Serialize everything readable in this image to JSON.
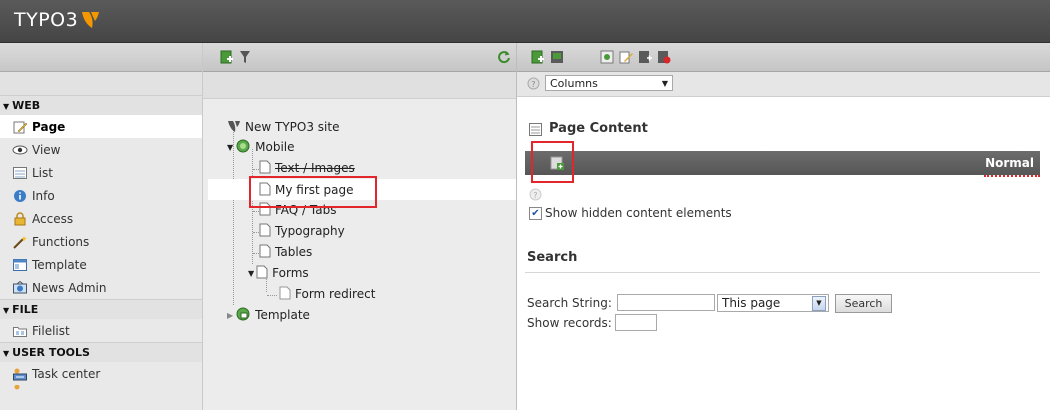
{
  "app": {
    "logo_text": "TYPO3"
  },
  "module_menu": {
    "groups": [
      {
        "label": "WEB",
        "items": [
          {
            "label": "Page",
            "icon": "page-edit-icon",
            "active": true
          },
          {
            "label": "View",
            "icon": "eye-icon"
          },
          {
            "label": "List",
            "icon": "list-icon"
          },
          {
            "label": "Info",
            "icon": "info-icon"
          },
          {
            "label": "Access",
            "icon": "lock-icon"
          },
          {
            "label": "Functions",
            "icon": "wand-icon"
          },
          {
            "label": "Template",
            "icon": "template-icon"
          },
          {
            "label": "News Admin",
            "icon": "news-icon"
          }
        ]
      },
      {
        "label": "FILE",
        "items": [
          {
            "label": "Filelist",
            "icon": "folder-icon"
          }
        ]
      },
      {
        "label": "USER TOOLS",
        "items": [
          {
            "label": "Task center",
            "icon": "task-icon"
          }
        ]
      }
    ]
  },
  "page_tree": {
    "root": "New TYPO3 site",
    "nodes": [
      {
        "label": "Mobile"
      },
      {
        "label": "Text / Images"
      },
      {
        "label": "My first page"
      },
      {
        "label": "FAQ / Tabs"
      },
      {
        "label": "Typography"
      },
      {
        "label": "Tables"
      },
      {
        "label": "Forms"
      },
      {
        "label": "Form redirect"
      },
      {
        "label": "Template"
      }
    ]
  },
  "content": {
    "view_select": "Columns",
    "section_title": "Page Content",
    "column_label": "Normal",
    "show_hidden_label": "Show hidden content elements",
    "show_hidden_checked": true,
    "search": {
      "title": "Search",
      "string_label": "Search String:",
      "scope_value": "This page",
      "button_label": "Search",
      "records_label": "Show records:"
    }
  },
  "colors": {
    "topbar": "#4f4f4f",
    "highlight_box": "#e3262b",
    "column_bar": "#5f5f5f"
  }
}
